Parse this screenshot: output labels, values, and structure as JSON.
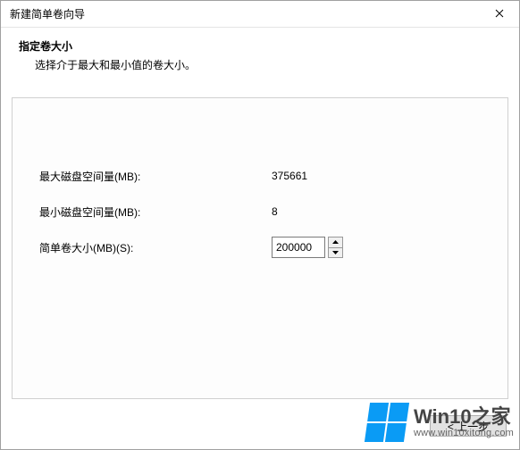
{
  "titlebar": {
    "title": "新建简单卷向导"
  },
  "header": {
    "title": "指定卷大小",
    "subtitle": "选择介于最大和最小值的卷大小。"
  },
  "fields": {
    "max_label": "最大磁盘空间量(MB):",
    "max_value": "375661",
    "min_label": "最小磁盘空间量(MB):",
    "min_value": "8",
    "size_label": "简单卷大小(MB)(S):",
    "size_value": "200000"
  },
  "footer": {
    "back_label": "< 上一步"
  },
  "watermark": {
    "main": "Win10",
    "zhi": "之家",
    "url": "www.win10xitong.com"
  }
}
